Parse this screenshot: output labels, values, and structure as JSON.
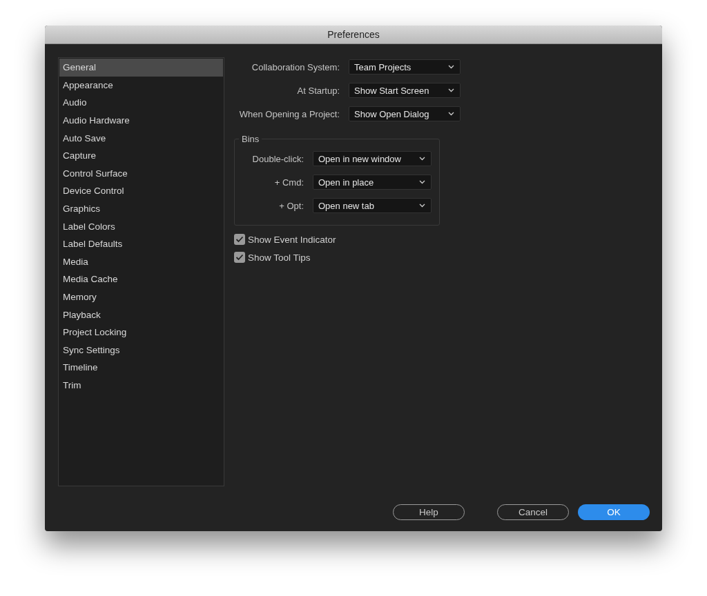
{
  "window": {
    "title": "Preferences"
  },
  "sidebar": {
    "items": [
      {
        "label": "General",
        "selected": true
      },
      {
        "label": "Appearance",
        "selected": false
      },
      {
        "label": "Audio",
        "selected": false
      },
      {
        "label": "Audio Hardware",
        "selected": false
      },
      {
        "label": "Auto Save",
        "selected": false
      },
      {
        "label": "Capture",
        "selected": false
      },
      {
        "label": "Control Surface",
        "selected": false
      },
      {
        "label": "Device Control",
        "selected": false
      },
      {
        "label": "Graphics",
        "selected": false
      },
      {
        "label": "Label Colors",
        "selected": false
      },
      {
        "label": "Label Defaults",
        "selected": false
      },
      {
        "label": "Media",
        "selected": false
      },
      {
        "label": "Media Cache",
        "selected": false
      },
      {
        "label": "Memory",
        "selected": false
      },
      {
        "label": "Playback",
        "selected": false
      },
      {
        "label": "Project Locking",
        "selected": false
      },
      {
        "label": "Sync Settings",
        "selected": false
      },
      {
        "label": "Timeline",
        "selected": false
      },
      {
        "label": "Trim",
        "selected": false
      }
    ]
  },
  "settings": [
    {
      "label": "Collaboration System:",
      "value": "Team Projects"
    },
    {
      "label": "At Startup:",
      "value": "Show Start Screen"
    },
    {
      "label": "When Opening a Project:",
      "value": "Show Open Dialog"
    }
  ],
  "bins": {
    "title": "Bins",
    "settings": [
      {
        "label": "Double-click:",
        "value": "Open in new window"
      },
      {
        "label": "+ Cmd:",
        "value": "Open in place"
      },
      {
        "label": "+ Opt:",
        "value": "Open new tab"
      }
    ]
  },
  "checkboxes": [
    {
      "label": "Show Event Indicator",
      "checked": true
    },
    {
      "label": "Show Tool Tips",
      "checked": true
    }
  ],
  "buttons": [
    {
      "label": "Help",
      "kind": "secondary"
    },
    {
      "label": "Cancel",
      "kind": "secondary"
    },
    {
      "label": "OK",
      "kind": "primary"
    }
  ]
}
